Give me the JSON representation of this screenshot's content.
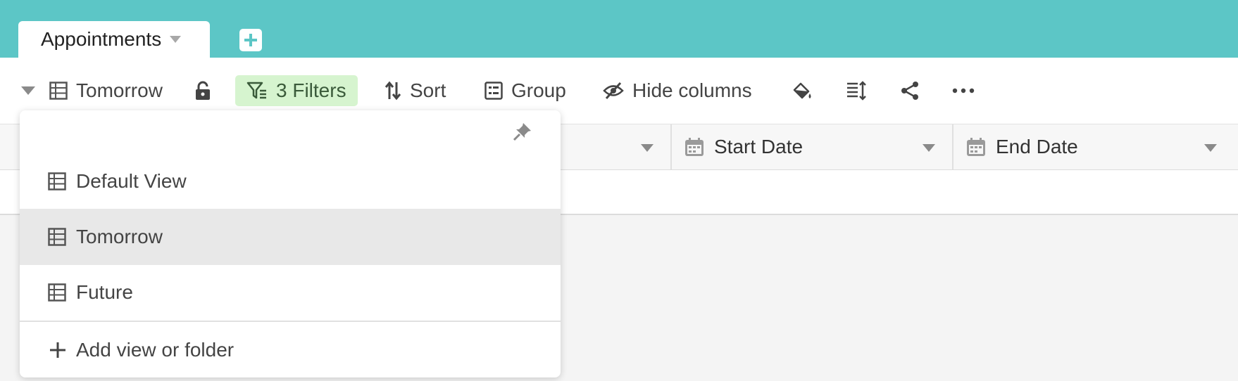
{
  "tabs": {
    "active_label": "Appointments",
    "add_tab_icon": "plus-icon"
  },
  "toolbar": {
    "current_view": "Tomorrow",
    "filters_label": "3 Filters",
    "sort_label": "Sort",
    "group_label": "Group",
    "hide_columns_label": "Hide columns",
    "icons": [
      "grid-icon",
      "lock-icon",
      "filter-icon",
      "sort-icon",
      "group-icon",
      "eye-slash-icon",
      "paint-bucket-icon",
      "row-height-icon",
      "share-icon",
      "more-icon"
    ]
  },
  "columns": [
    {
      "label": "",
      "icon": ""
    },
    {
      "label": "Start Date",
      "icon": "calendar-icon"
    },
    {
      "label": "End Date",
      "icon": "calendar-icon"
    }
  ],
  "view_menu": {
    "items": [
      {
        "label": "Default View",
        "selected": false
      },
      {
        "label": "Tomorrow",
        "selected": true
      },
      {
        "label": "Future",
        "selected": false
      }
    ],
    "add_label": "Add view or folder"
  },
  "colors": {
    "accent": "#5cc6c6",
    "filter_highlight": "#d6f4cf",
    "selected_row": "#e8e8e8"
  }
}
